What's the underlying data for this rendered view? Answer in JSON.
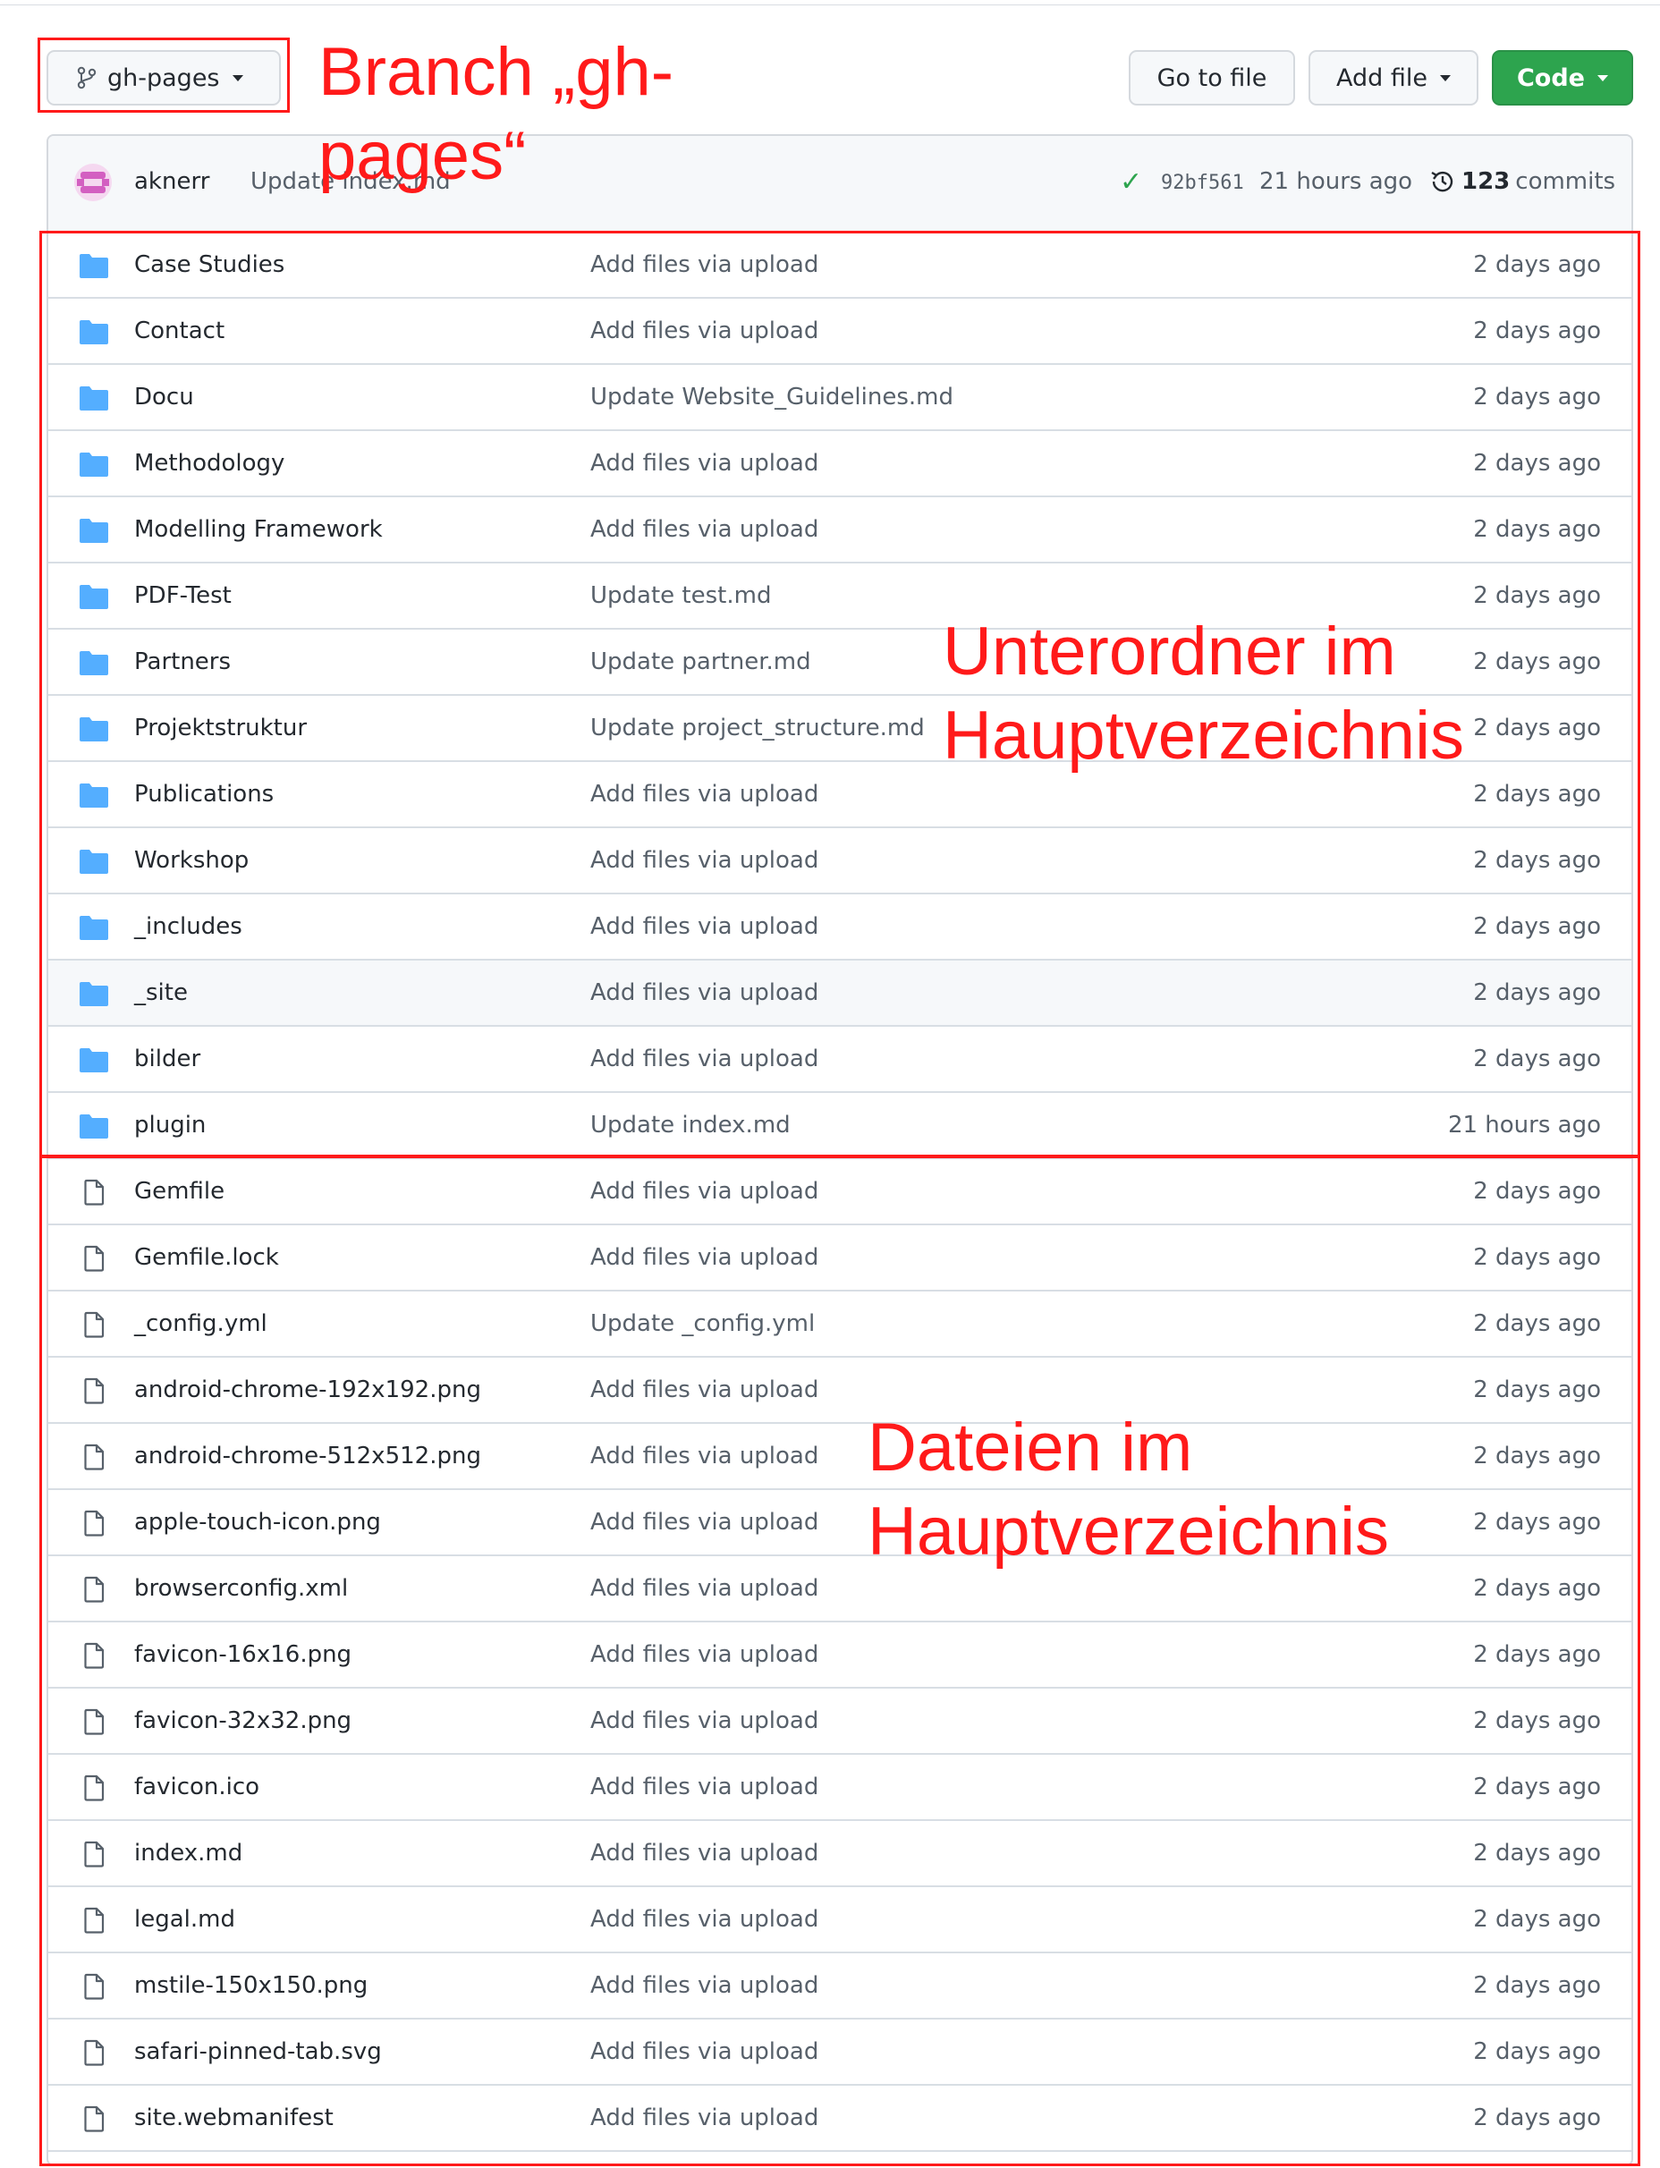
{
  "toolbar": {
    "branch_label": "gh-pages",
    "goto_label": "Go to file",
    "addfile_label": "Add file",
    "code_label": "Code",
    "code_color": "#2da44e"
  },
  "commit": {
    "author": "aknerr",
    "message": "Update index.md",
    "sha": "92bf561",
    "time": "21 hours ago",
    "commits_count": "123",
    "commits_label": "commits",
    "status": "success"
  },
  "files": [
    {
      "type": "folder",
      "name": "Case Studies",
      "message": "Add files via upload",
      "age": "2 days ago"
    },
    {
      "type": "folder",
      "name": "Contact",
      "message": "Add files via upload",
      "age": "2 days ago"
    },
    {
      "type": "folder",
      "name": "Docu",
      "message": "Update Website_Guidelines.md",
      "age": "2 days ago"
    },
    {
      "type": "folder",
      "name": "Methodology",
      "message": "Add files via upload",
      "age": "2 days ago"
    },
    {
      "type": "folder",
      "name": "Modelling Framework",
      "message": "Add files via upload",
      "age": "2 days ago"
    },
    {
      "type": "folder",
      "name": "PDF-Test",
      "message": "Update test.md",
      "age": "2 days ago"
    },
    {
      "type": "folder",
      "name": "Partners",
      "message": "Update partner.md",
      "age": "2 days ago"
    },
    {
      "type": "folder",
      "name": "Projektstruktur",
      "message": "Update project_structure.md",
      "age": "2 days ago"
    },
    {
      "type": "folder",
      "name": "Publications",
      "message": "Add files via upload",
      "age": "2 days ago"
    },
    {
      "type": "folder",
      "name": "Workshop",
      "message": "Add files via upload",
      "age": "2 days ago"
    },
    {
      "type": "folder",
      "name": "_includes",
      "message": "Add files via upload",
      "age": "2 days ago"
    },
    {
      "type": "folder",
      "name": "_site",
      "message": "Add files via upload",
      "age": "2 days ago",
      "highlighted": true
    },
    {
      "type": "folder",
      "name": "bilder",
      "message": "Add files via upload",
      "age": "2 days ago"
    },
    {
      "type": "folder",
      "name": "plugin",
      "message": "Update index.md",
      "age": "21 hours ago"
    },
    {
      "type": "file",
      "name": "Gemfile",
      "message": "Add files via upload",
      "age": "2 days ago"
    },
    {
      "type": "file",
      "name": "Gemfile.lock",
      "message": "Add files via upload",
      "age": "2 days ago"
    },
    {
      "type": "file",
      "name": "_config.yml",
      "message": "Update _config.yml",
      "age": "2 days ago"
    },
    {
      "type": "file",
      "name": "android-chrome-192x192.png",
      "message": "Add files via upload",
      "age": "2 days ago"
    },
    {
      "type": "file",
      "name": "android-chrome-512x512.png",
      "message": "Add files via upload",
      "age": "2 days ago"
    },
    {
      "type": "file",
      "name": "apple-touch-icon.png",
      "message": "Add files via upload",
      "age": "2 days ago"
    },
    {
      "type": "file",
      "name": "browserconfig.xml",
      "message": "Add files via upload",
      "age": "2 days ago"
    },
    {
      "type": "file",
      "name": "favicon-16x16.png",
      "message": "Add files via upload",
      "age": "2 days ago"
    },
    {
      "type": "file",
      "name": "favicon-32x32.png",
      "message": "Add files via upload",
      "age": "2 days ago"
    },
    {
      "type": "file",
      "name": "favicon.ico",
      "message": "Add files via upload",
      "age": "2 days ago"
    },
    {
      "type": "file",
      "name": "index.md",
      "message": "Add files via upload",
      "age": "2 days ago"
    },
    {
      "type": "file",
      "name": "legal.md",
      "message": "Add files via upload",
      "age": "2 days ago"
    },
    {
      "type": "file",
      "name": "mstile-150x150.png",
      "message": "Add files via upload",
      "age": "2 days ago"
    },
    {
      "type": "file",
      "name": "safari-pinned-tab.svg",
      "message": "Add files via upload",
      "age": "2 days ago"
    },
    {
      "type": "file",
      "name": "site.webmanifest",
      "message": "Add files via upload",
      "age": "2 days ago"
    }
  ],
  "annotations": {
    "branch_line1": "Branch „gh-",
    "branch_line2": "pages“",
    "folders_line1": "Unterordner im",
    "folders_line2": "Hauptverzeichnis",
    "files_line1": "Dateien im",
    "files_line2": "Hauptverzeichnis",
    "color": "#ff1a1a"
  },
  "icons": {
    "branch": "git-branch-icon",
    "folder": "folder-icon",
    "file": "file-icon",
    "check": "check-icon",
    "history": "history-icon"
  }
}
